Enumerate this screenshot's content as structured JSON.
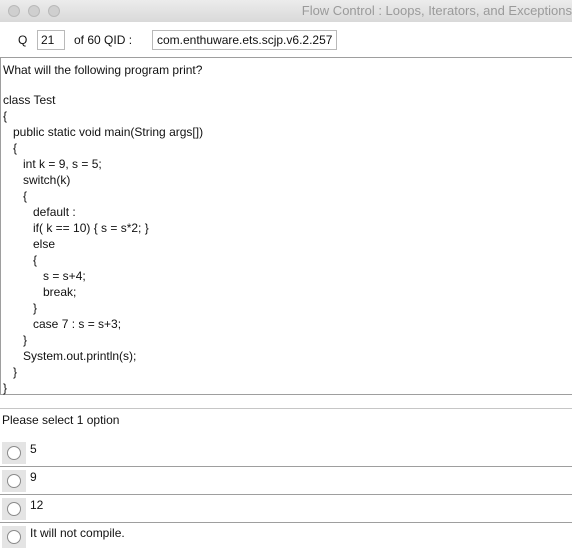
{
  "window": {
    "title": "Flow Control : Loops, Iterators, and Exceptions"
  },
  "question_bar": {
    "q_label": "Q",
    "number": "21",
    "of_text": "of 60 QID :",
    "qid": "com.enthuware.ets.scjp.v6.2.257"
  },
  "question": {
    "prompt": "What will the following program print?",
    "code_lines": [
      "class Test",
      "{",
      "   public static void main(String args[])",
      "   {",
      "      int k = 9, s = 5;",
      "      switch(k)",
      "      {",
      "         default :",
      "         if( k == 10) { s = s*2; }",
      "         else",
      "         {",
      "            s = s+4;",
      "            break;",
      "         }",
      "         case 7 : s = s+3;",
      "      }",
      "      System.out.println(s);",
      "   }",
      "}"
    ]
  },
  "options": {
    "heading": "Please select 1 option",
    "items": [
      {
        "label": "5"
      },
      {
        "label": "9"
      },
      {
        "label": "12"
      },
      {
        "label": "It will not compile."
      }
    ]
  }
}
